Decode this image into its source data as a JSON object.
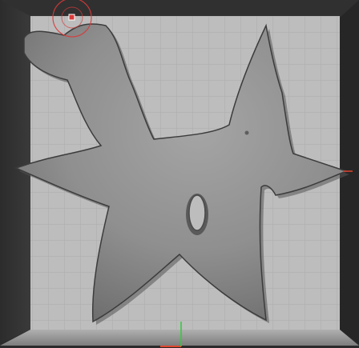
{
  "viewport": {
    "background_color": "#2b2b2b",
    "canvas_color": "#bdbdbd",
    "grid_line_color": "#a9a9a9",
    "floor_color": "#9a9a9a",
    "mesh_color": "#8c8c8c",
    "brush_cursor_color": "#d93a3a",
    "axis_x_color": "#e0442c",
    "axis_y_color": "#2fcc38"
  },
  "icons": {
    "brush_cursor": "brush-cursor-icon"
  }
}
